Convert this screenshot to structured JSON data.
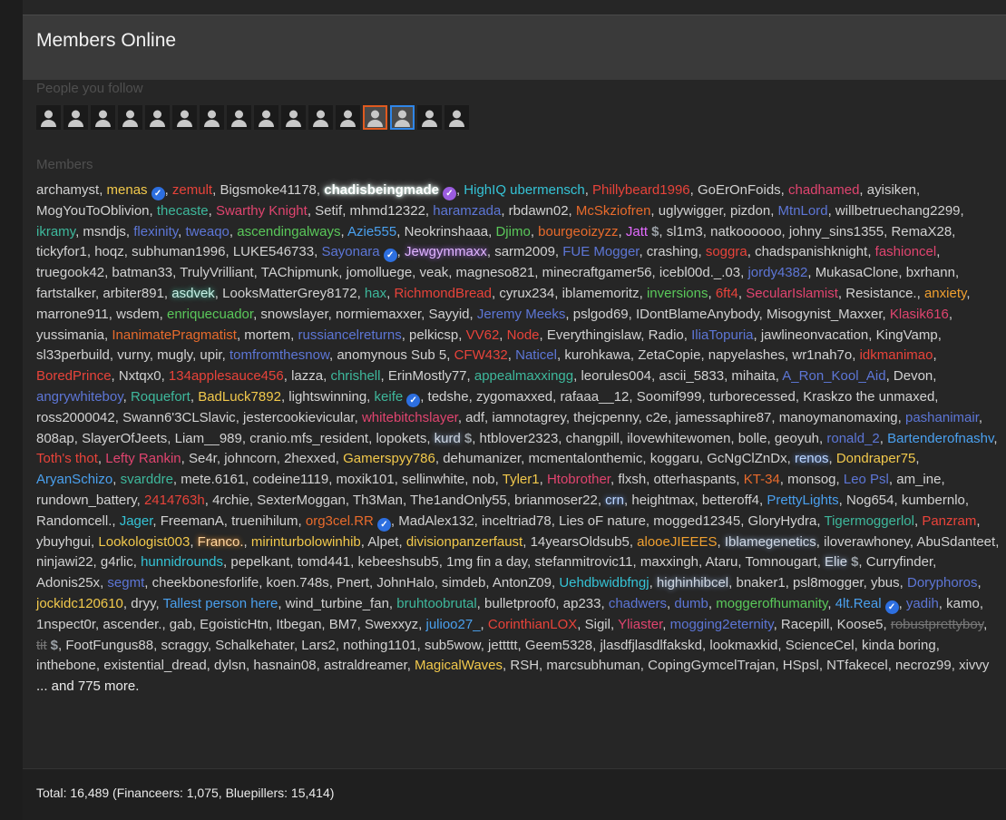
{
  "header": {
    "title": "Members Online"
  },
  "follow": {
    "label": "People you follow",
    "avatars": [
      "default",
      "default",
      "default",
      "default",
      "default",
      "default",
      "default",
      "default",
      "default",
      "default",
      "default",
      "default",
      "orange",
      "blue",
      "default",
      "default"
    ]
  },
  "members": {
    "label": "Members",
    "list": [
      {
        "n": "archamyst"
      },
      {
        "n": "menas",
        "c": "#f2c94c",
        "b": "blue"
      },
      {
        "n": "zemult",
        "c": "#e8433a"
      },
      {
        "n": "Bigsmoke41178"
      },
      {
        "n": "chadisbeingmade",
        "g": "white",
        "b": "purple"
      },
      {
        "n": "HighIQ ubermensch",
        "c": "#35c3d6"
      },
      {
        "n": "Phillybeard1996",
        "c": "#e8433a"
      },
      {
        "n": "GoErOnFoids"
      },
      {
        "n": "chadhamed",
        "c": "#e0446f"
      },
      {
        "n": "ayisiken"
      },
      {
        "n": "MogYouToOblivion"
      },
      {
        "n": "thecaste",
        "c": "#3eb89c"
      },
      {
        "n": "Swarthy Knight",
        "c": "#e0446f"
      },
      {
        "n": "Setif"
      },
      {
        "n": "mhmd12322"
      },
      {
        "n": "haramzada",
        "c": "#5d76d6"
      },
      {
        "n": "rbdawn02"
      },
      {
        "n": "McSkziofren",
        "c": "#e86b2c"
      },
      {
        "n": "uglywigger"
      },
      {
        "n": "pizdon"
      },
      {
        "n": "MtnLord",
        "c": "#5d76d6"
      },
      {
        "n": "willbetruechang2299"
      },
      {
        "n": "ikramy",
        "c": "#3eb89c"
      },
      {
        "n": "msndjs"
      },
      {
        "n": "flexinity",
        "c": "#5d76d6"
      },
      {
        "n": "tweaqo",
        "c": "#5d76d6"
      },
      {
        "n": "ascendingalways",
        "c": "#5ac85a"
      },
      {
        "n": "Azie555",
        "c": "#4aa0ee"
      },
      {
        "n": "Neokrinshaaa"
      },
      {
        "n": "Djimo",
        "c": "#5ac85a"
      },
      {
        "n": "bourgeoizyzz",
        "c": "#e86b2c"
      },
      {
        "n": "Jatt",
        "c": "#e36bff",
        "d": true
      },
      {
        "n": "sl1m3"
      },
      {
        "n": "natkoooooo"
      },
      {
        "n": "johny_sins1355"
      },
      {
        "n": "RemaX28"
      },
      {
        "n": "tickyfor1"
      },
      {
        "n": "hoqz"
      },
      {
        "n": "subhuman1996"
      },
      {
        "n": "LUKE546733"
      },
      {
        "n": "Sayonara",
        "c": "#5d76d6",
        "b": "blue"
      },
      {
        "n": "Jewgymmaxx",
        "g": "purple"
      },
      {
        "n": "sarm2009"
      },
      {
        "n": "FUE Mogger",
        "c": "#5d76d6"
      },
      {
        "n": "crashing"
      },
      {
        "n": "soggra",
        "c": "#e8433a"
      },
      {
        "n": "chadspanishknight"
      },
      {
        "n": "fashioncel",
        "c": "#e0446f"
      },
      {
        "n": "truegook42"
      },
      {
        "n": "batman33"
      },
      {
        "n": "TrulyVrilliant"
      },
      {
        "n": "TAChipmunk"
      },
      {
        "n": "jomolluege"
      },
      {
        "n": "veak"
      },
      {
        "n": "magneso821"
      },
      {
        "n": "minecraftgamer56"
      },
      {
        "n": "icebl00d._.03"
      },
      {
        "n": "jordy4382",
        "c": "#5d76d6"
      },
      {
        "n": "MukasaClone"
      },
      {
        "n": "bxrhann"
      },
      {
        "n": "fartstalker"
      },
      {
        "n": "arbiter891"
      },
      {
        "n": "asdvek",
        "g": "teal"
      },
      {
        "n": "LooksMatterGrey8172"
      },
      {
        "n": "hax",
        "c": "#3eb89c"
      },
      {
        "n": "RichmondBread",
        "c": "#e8433a"
      },
      {
        "n": "cyrux234"
      },
      {
        "n": "iblamemoritz"
      },
      {
        "n": "inversions",
        "c": "#5ac85a"
      },
      {
        "n": "6ft4",
        "c": "#e8433a"
      },
      {
        "n": "SecularIslamist",
        "c": "#e0446f"
      },
      {
        "n": "Resistance."
      },
      {
        "n": "anxiety",
        "c": "#f0a030"
      },
      {
        "n": "marrone911"
      },
      {
        "n": "wsdem"
      },
      {
        "n": "enriquecuador",
        "c": "#5ac85a"
      },
      {
        "n": "snowslayer"
      },
      {
        "n": "normiemaxxer"
      },
      {
        "n": "Sayyid"
      },
      {
        "n": "Jeremy Meeks",
        "c": "#5d76d6"
      },
      {
        "n": "pslgod69"
      },
      {
        "n": "IDontBlameAnybody"
      },
      {
        "n": "Misogynist_Maxxer"
      },
      {
        "n": "Klasik616",
        "c": "#e0446f"
      },
      {
        "n": "yussimania"
      },
      {
        "n": "InanimatePragmatist",
        "c": "#e86b2c"
      },
      {
        "n": "mortem"
      },
      {
        "n": "russiancelreturns",
        "c": "#5d76d6"
      },
      {
        "n": "pelkicsp"
      },
      {
        "n": "VV62",
        "c": "#e8433a"
      },
      {
        "n": "Node",
        "c": "#e8433a"
      },
      {
        "n": "Everythingislaw"
      },
      {
        "n": "Radio"
      },
      {
        "n": "IliaTopuria",
        "c": "#5d76d6"
      },
      {
        "n": "jawlineonvacation"
      },
      {
        "n": "KingVamp"
      },
      {
        "n": "sl33perbuild"
      },
      {
        "n": "vurny"
      },
      {
        "n": "mugly"
      },
      {
        "n": "upir"
      },
      {
        "n": "tomfromthesnow",
        "c": "#5d76d6"
      },
      {
        "n": "anomynous Sub 5"
      },
      {
        "n": "CFW432",
        "c": "#e8433a"
      },
      {
        "n": "Naticel",
        "c": "#5d76d6"
      },
      {
        "n": "kurohkawa"
      },
      {
        "n": "ZetaCopie"
      },
      {
        "n": "napyelashes"
      },
      {
        "n": "wr1nah7o"
      },
      {
        "n": "idkmanimao",
        "c": "#e8433a"
      },
      {
        "n": "BoredPrince",
        "c": "#e8433a"
      },
      {
        "n": "Nxtqx0"
      },
      {
        "n": "134applesauce456",
        "c": "#e8433a"
      },
      {
        "n": "lazza"
      },
      {
        "n": "chrishell",
        "c": "#3eb89c"
      },
      {
        "n": "ErinMostly77"
      },
      {
        "n": "appealmaxxingg",
        "c": "#3eb89c"
      },
      {
        "n": "leorules004"
      },
      {
        "n": "ascii_5833"
      },
      {
        "n": "mihaita"
      },
      {
        "n": "A_Ron_Kool_Aid",
        "c": "#5d76d6"
      },
      {
        "n": "Devon"
      },
      {
        "n": "angrywhiteboy",
        "c": "#5d76d6"
      },
      {
        "n": "Roquefort",
        "c": "#3eb89c"
      },
      {
        "n": "BadLuck7892",
        "c": "#f2c94c"
      },
      {
        "n": "lightswinning"
      },
      {
        "n": "keife",
        "c": "#3eb89c",
        "b": "blue"
      },
      {
        "n": "tedshe"
      },
      {
        "n": "zygomaxxed"
      },
      {
        "n": "rafaaa__12"
      },
      {
        "n": "Soomif999"
      },
      {
        "n": "turborecessed"
      },
      {
        "n": "Kraskzo the unmaxed"
      },
      {
        "n": "ross2000042"
      },
      {
        "n": "Swann6'3CLSlavic"
      },
      {
        "n": "jestercookievicular"
      },
      {
        "n": "whitebitchslayer",
        "c": "#e0446f"
      },
      {
        "n": "adf"
      },
      {
        "n": "iamnotagrey"
      },
      {
        "n": "thejcpenny"
      },
      {
        "n": "c2e"
      },
      {
        "n": "jamessaphire87"
      },
      {
        "n": "manoymanomaxing"
      },
      {
        "n": "pashanimair",
        "c": "#5d76d6"
      },
      {
        "n": "808ap"
      },
      {
        "n": "SlayerOfJeets"
      },
      {
        "n": "Liam__989"
      },
      {
        "n": "cranio.mfs_resident"
      },
      {
        "n": "lopokets"
      },
      {
        "n": "kurd",
        "g": "gray",
        "d": true
      },
      {
        "n": "htblover2323"
      },
      {
        "n": "changpill"
      },
      {
        "n": "ilovewhitewomen"
      },
      {
        "n": "bolle"
      },
      {
        "n": "geoyuh"
      },
      {
        "n": "ronald_2",
        "c": "#5d76d6"
      },
      {
        "n": "Bartenderofnashv",
        "c": "#4aa0ee"
      },
      {
        "n": "Toth's thot",
        "c": "#e8433a"
      },
      {
        "n": "Lefty Rankin",
        "c": "#e0446f"
      },
      {
        "n": "Se4r"
      },
      {
        "n": "johncorn"
      },
      {
        "n": "2hexxed"
      },
      {
        "n": "Gamerspyy786",
        "c": "#f2c94c"
      },
      {
        "n": "dehumanizer"
      },
      {
        "n": "mcmentalonthemic"
      },
      {
        "n": "koggaru"
      },
      {
        "n": "GcNgClZnDx"
      },
      {
        "n": "renos",
        "g": "blue"
      },
      {
        "n": "Dondraper75",
        "c": "#f2c94c"
      },
      {
        "n": "AryanSchizo",
        "c": "#4aa0ee"
      },
      {
        "n": "svarddre",
        "c": "#3eb89c"
      },
      {
        "n": "mete.6161"
      },
      {
        "n": "codeine1119"
      },
      {
        "n": "moxik101"
      },
      {
        "n": "sellinwhite"
      },
      {
        "n": "nob"
      },
      {
        "n": "Tyler1",
        "c": "#f2c94c"
      },
      {
        "n": "Htobrother",
        "c": "#e0446f"
      },
      {
        "n": "flxsh"
      },
      {
        "n": "otterhaspants"
      },
      {
        "n": "KT-34",
        "c": "#e86b2c"
      },
      {
        "n": "monsog"
      },
      {
        "n": "Leo Psl",
        "c": "#5d76d6"
      },
      {
        "n": "am_ine"
      },
      {
        "n": "rundown_battery"
      },
      {
        "n": "2414763h",
        "c": "#e8433a"
      },
      {
        "n": "4rchie"
      },
      {
        "n": "SexterMoggan"
      },
      {
        "n": "Th3Man"
      },
      {
        "n": "The1andOnly55"
      },
      {
        "n": "brianmoser22"
      },
      {
        "n": "crn",
        "g": "blue"
      },
      {
        "n": "heightmax"
      },
      {
        "n": "betteroff4"
      },
      {
        "n": "PrettyLights",
        "c": "#4aa0ee"
      },
      {
        "n": "Nog654"
      },
      {
        "n": "kumbernlo"
      },
      {
        "n": "Randomcell."
      },
      {
        "n": "Jager",
        "c": "#35c3d6"
      },
      {
        "n": "FreemanA"
      },
      {
        "n": "truenihilum"
      },
      {
        "n": "org3cel.RR",
        "c": "#e86b2c",
        "b": "blue"
      },
      {
        "n": "MadAlex132"
      },
      {
        "n": "inceltriad78"
      },
      {
        "n": "Lies oF nature"
      },
      {
        "n": "mogged12345"
      },
      {
        "n": "GloryHydra"
      },
      {
        "n": "Tigermoggerlol",
        "c": "#3eb89c"
      },
      {
        "n": "Panzram",
        "c": "#e8433a"
      },
      {
        "n": "ybuyhgui"
      },
      {
        "n": "Lookologist003",
        "c": "#f2c94c"
      },
      {
        "n": "Franco.",
        "g": "orange"
      },
      {
        "n": "mirinturbolowinhib",
        "c": "#f2c94c"
      },
      {
        "n": "Alpet"
      },
      {
        "n": "divisionpanzerfaust",
        "c": "#f2c94c"
      },
      {
        "n": "14yearsOldsub5"
      },
      {
        "n": "alooeJIEEES",
        "c": "#f0a030"
      },
      {
        "n": "Iblamegenetics",
        "g": "gray"
      },
      {
        "n": "iloverawhoney"
      },
      {
        "n": "AbuSdanteet"
      },
      {
        "n": "ninjawi22"
      },
      {
        "n": "g4rlic"
      },
      {
        "n": "hunnidrounds",
        "c": "#35c3d6"
      },
      {
        "n": "pepelkant"
      },
      {
        "n": "tomd441"
      },
      {
        "n": "kebeeshsub5"
      },
      {
        "n": "1mg fin a day"
      },
      {
        "n": "stefanmitrovic11"
      },
      {
        "n": "maxxingh"
      },
      {
        "n": "Ataru"
      },
      {
        "n": "Tomnougart"
      },
      {
        "n": "Elie",
        "g": "gray",
        "d": true
      },
      {
        "n": "Curryfinder"
      },
      {
        "n": "Adonis25x"
      },
      {
        "n": "segmt",
        "c": "#5d76d6"
      },
      {
        "n": "cheekbonesforlife"
      },
      {
        "n": "koen.748s"
      },
      {
        "n": "Pnert"
      },
      {
        "n": "JohnHalo"
      },
      {
        "n": "simdeb"
      },
      {
        "n": "AntonZ09"
      },
      {
        "n": "Uehdbwidbfngj",
        "c": "#35c3d6"
      },
      {
        "n": "highinhibcel",
        "g": "gray"
      },
      {
        "n": "bnaker1"
      },
      {
        "n": "psl8mogger"
      },
      {
        "n": "ybus"
      },
      {
        "n": "Doryphoros",
        "c": "#5d76d6"
      },
      {
        "n": "jockidc120610",
        "c": "#f2c94c"
      },
      {
        "n": "dryy"
      },
      {
        "n": "Tallest person here",
        "c": "#4aa0ee"
      },
      {
        "n": "wind_turbine_fan"
      },
      {
        "n": "bruhtoobrutal",
        "c": "#3eb89c"
      },
      {
        "n": "bulletproof0"
      },
      {
        "n": "ap233"
      },
      {
        "n": "chadwers",
        "c": "#5d76d6"
      },
      {
        "n": "dumb",
        "c": "#5d76d6"
      },
      {
        "n": "moggerofhumanity",
        "c": "#5ac85a"
      },
      {
        "n": "4lt.Real",
        "c": "#4aa0ee",
        "b": "blue"
      },
      {
        "n": "yadih",
        "c": "#5d76d6"
      },
      {
        "n": "kamo"
      },
      {
        "n": "1nspect0r"
      },
      {
        "n": "ascender."
      },
      {
        "n": "gab"
      },
      {
        "n": "EgoisticHtn"
      },
      {
        "n": "Itbegan"
      },
      {
        "n": "BM7"
      },
      {
        "n": "Swexxyz"
      },
      {
        "n": "julioo27_",
        "c": "#4aa0ee"
      },
      {
        "n": "CorinthianLOX",
        "c": "#e8433a"
      },
      {
        "n": "Sigil"
      },
      {
        "n": "Yliaster",
        "c": "#e0446f"
      },
      {
        "n": "mogging2eternity",
        "c": "#5d76d6"
      },
      {
        "n": "Racepill"
      },
      {
        "n": "Koose5"
      },
      {
        "n": "robustprettyboy",
        "s": true
      },
      {
        "n": "tit",
        "s": true,
        "d": true
      },
      {
        "n": "FootFungus88"
      },
      {
        "n": "scraggy"
      },
      {
        "n": "Schalkehater"
      },
      {
        "n": "Lars2"
      },
      {
        "n": "nothing1101"
      },
      {
        "n": "sub5wow"
      },
      {
        "n": "jettttt"
      },
      {
        "n": "Geem5328"
      },
      {
        "n": "jlasdfjlasdlfakskd"
      },
      {
        "n": "lookmaxkid"
      },
      {
        "n": "ScienceCel"
      },
      {
        "n": "kinda boring"
      },
      {
        "n": "inthebone"
      },
      {
        "n": "existential_dread"
      },
      {
        "n": "dylsn"
      },
      {
        "n": "hasnain08"
      },
      {
        "n": "astraldreamer"
      },
      {
        "n": "MagicalWaves",
        "c": "#f2c94c"
      },
      {
        "n": "RSH"
      },
      {
        "n": "marcsubhuman"
      },
      {
        "n": "CopingGymcelTrajan"
      },
      {
        "n": "HSpsl"
      },
      {
        "n": "NTfakecel"
      },
      {
        "n": "necroz99"
      },
      {
        "n": "xivvy"
      }
    ],
    "more": "... and 775 more."
  },
  "footer": {
    "total": "Total: 16,489 (Financeers: 1,075, Bluepillers: 15,414)"
  }
}
